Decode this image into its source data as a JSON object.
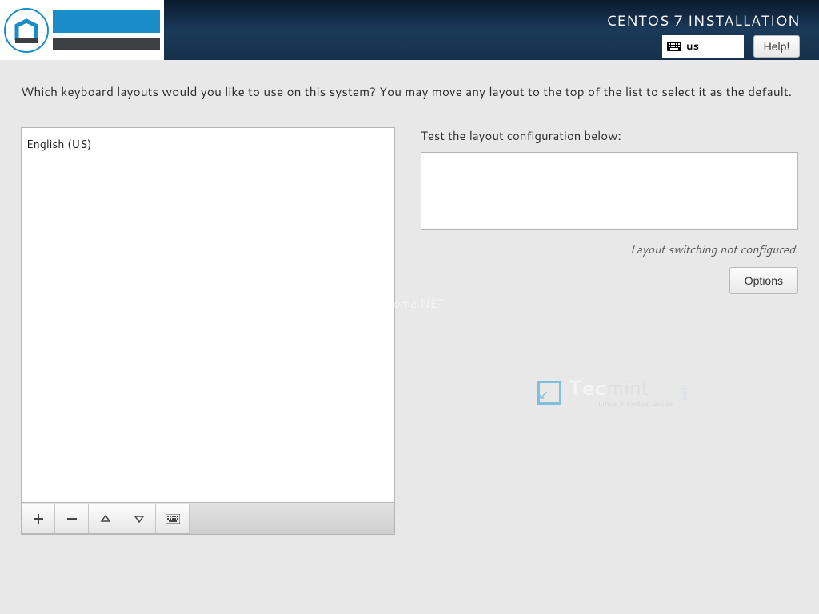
{
  "header": {
    "title": "CENTOS 7 INSTALLATION",
    "kbd_layout": "us",
    "help_label": "Help!"
  },
  "main": {
    "prompt": "Which keyboard layouts would you like to use on this system?  You may move any layout to the top of the list to select it as the default.",
    "layouts": [
      "English (US)"
    ],
    "test_label": "Test the layout configuration below:",
    "switch_note": "Layout switching not configured.",
    "options_label": "Options"
  },
  "toolbar": {
    "add": "+",
    "remove": "−",
    "up": "▲",
    "down": "▼"
  },
  "watermarks": {
    "wm1": "linuxhome.NET",
    "wm2_tec": "Tec",
    "wm2_mint": "mint",
    "wm2_sub": "Linux Howtos Guide",
    "wm2_com": ".com"
  }
}
